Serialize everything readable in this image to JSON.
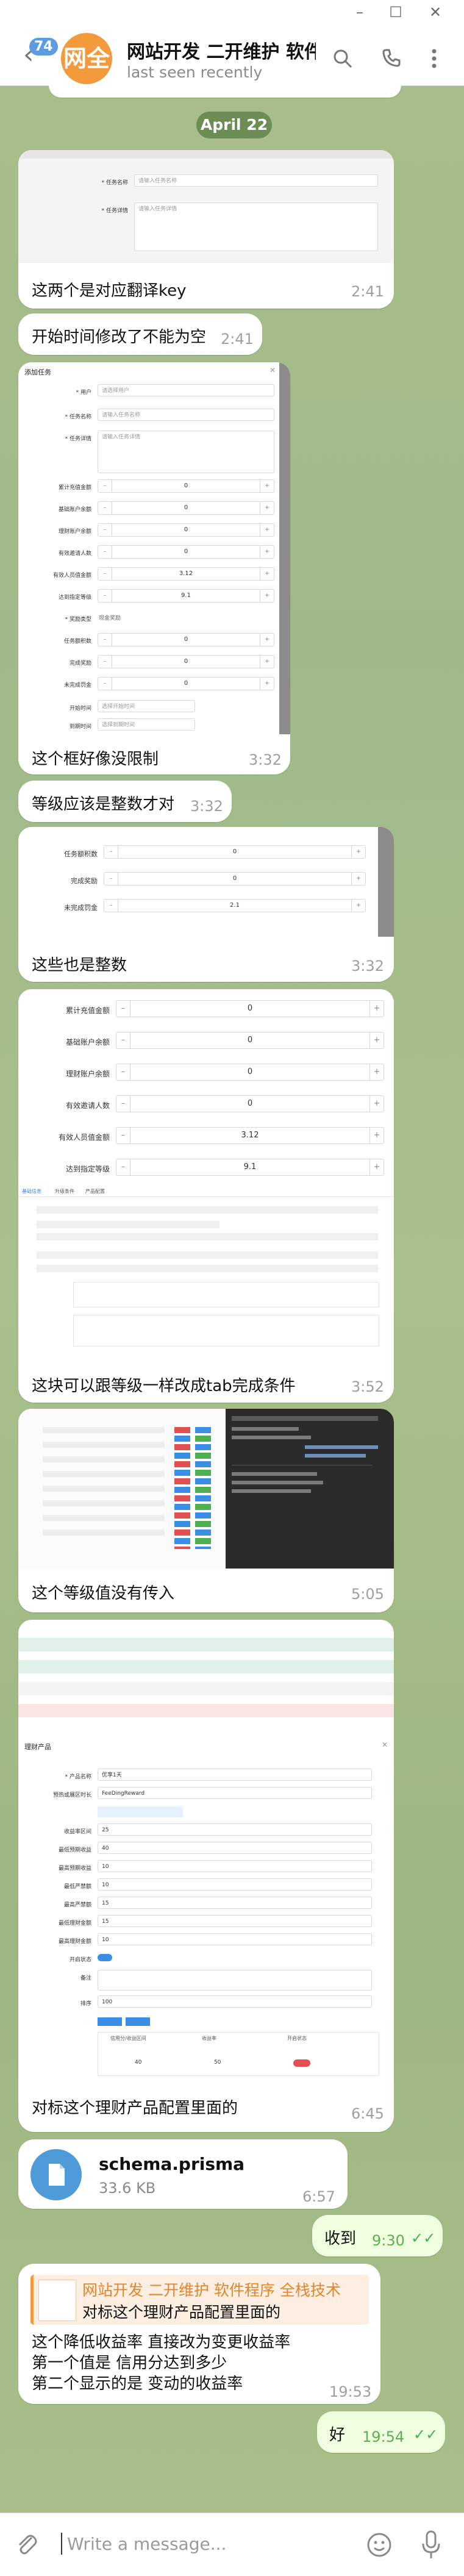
{
  "window": {
    "unread_badge": "74",
    "chat_title": "网站开发 二开维护 软件...",
    "avatar_text": "网全",
    "last_seen": "last seen recently"
  },
  "date_chip": "April 22",
  "messages": [
    {
      "caption": "这两个是对应翻译key",
      "time": "2:41"
    },
    {
      "caption": "开始时间修改了不能为空",
      "time": "2:41"
    },
    {
      "caption": "这个框好像没限制",
      "time": "3:32"
    },
    {
      "caption": "等级应该是整数才对",
      "time": "3:32"
    },
    {
      "caption": "这些也是整数",
      "time": "3:32"
    },
    {
      "caption": "这块可以跟等级一样改成tab完成条件",
      "time": "3:52"
    },
    {
      "caption": "这个等级值没有传入",
      "time": "5:05"
    },
    {
      "caption": "对标这个理财产品配置里面的",
      "time": "6:45"
    }
  ],
  "file_message": {
    "name": "schema.prisma",
    "size": "33.6 KB",
    "time": "6:57"
  },
  "outgoing": [
    {
      "text": "收到",
      "time": "9:30"
    },
    {
      "text": "好",
      "time": "19:54"
    }
  ],
  "reply_message": {
    "quote_author": "网站开发 二开维护 软件程序 全栈技术",
    "quote_text": "对标这个理财产品配置里面的",
    "lines": [
      "这个降低收益率 直接改为变更收益率",
      "第一个值是 信用分达到多少",
      "第二个显示的是 变动的收益率"
    ],
    "time": "19:53"
  },
  "shot1": {
    "rows": [
      {
        "label": "* 任务名称",
        "placeholder": "请输入任务名称"
      },
      {
        "label": "* 任务详情",
        "placeholder": "请输入任务详情"
      }
    ]
  },
  "shot2": {
    "title": "添加任务",
    "rows_text": [
      {
        "label": "* 用户",
        "placeholder": "请选择用户"
      },
      {
        "label": "* 任务名称",
        "placeholder": "请输入任务名称"
      },
      {
        "label": "* 任务详情",
        "placeholder": "请输入任务详情"
      }
    ],
    "rows_num": [
      {
        "label": "累计充值金额",
        "value": "0"
      },
      {
        "label": "基础账户余额",
        "value": "0"
      },
      {
        "label": "理财账户余额",
        "value": "0"
      },
      {
        "label": "有效邀请人数",
        "value": "0"
      },
      {
        "label": "有效人员值金额",
        "value": "3.12"
      },
      {
        "label": "达到指定等级",
        "value": "9.1"
      }
    ],
    "reward_label": "* 奖励类型",
    "reward_value": "现金奖励",
    "rows_num2": [
      {
        "label": "任务额积数",
        "value": "0"
      },
      {
        "label": "完成奖励",
        "value": "0"
      },
      {
        "label": "未完成罚金",
        "value": "0"
      }
    ],
    "rows_date": [
      {
        "label": "开始时间",
        "placeholder": "选择开始时间"
      },
      {
        "label": "到期时间",
        "placeholder": "选择到期时间"
      }
    ]
  },
  "shot3": {
    "rows": [
      {
        "label": "任务额积数",
        "value": "0"
      },
      {
        "label": "完成奖励",
        "value": "0"
      },
      {
        "label": "未完成罚金",
        "value": "2.1"
      }
    ]
  },
  "shot4": {
    "rows": [
      {
        "label": "累计充值金额",
        "value": "0"
      },
      {
        "label": "基础账户余额",
        "value": "0"
      },
      {
        "label": "理财账户余额",
        "value": "0"
      },
      {
        "label": "有效邀请人数",
        "value": "0"
      },
      {
        "label": "有效人员值金额",
        "value": "3.12"
      },
      {
        "label": "达到指定等级",
        "value": "9.1"
      }
    ],
    "tabs": [
      "基础信息",
      "升级条件",
      "产品配置"
    ]
  },
  "shot6": {
    "title": "理财产品",
    "rows": [
      {
        "label": "* 产品名称",
        "value": "优享1天"
      },
      {
        "label": "预热或展区时长",
        "value": "FeeDingReward"
      },
      {
        "label": "收益率区间",
        "value": "25"
      },
      {
        "label": "最低预期收益",
        "value": "40"
      },
      {
        "label": "最高预期收益",
        "value": "10"
      },
      {
        "label": "最低严禁额",
        "value": "10"
      },
      {
        "label": "最高严禁额",
        "value": "15"
      },
      {
        "label": "最低理财金额",
        "value": "15"
      },
      {
        "label": "最高理财金额",
        "value": "10"
      }
    ],
    "enable_label": "开启状态",
    "note_label": "备注",
    "sort_label": "排序",
    "sort_value": "100",
    "table_headers": [
      "信用分/收益区间",
      "收益率",
      "开启状态"
    ],
    "table_row": [
      "40",
      "50"
    ]
  },
  "input_placeholder": "Write a message...",
  "colors": {
    "accent": "#5e9be0",
    "avatar": "#f39a3c",
    "outgoing": "#eefedf",
    "check": "#4fae4f"
  }
}
